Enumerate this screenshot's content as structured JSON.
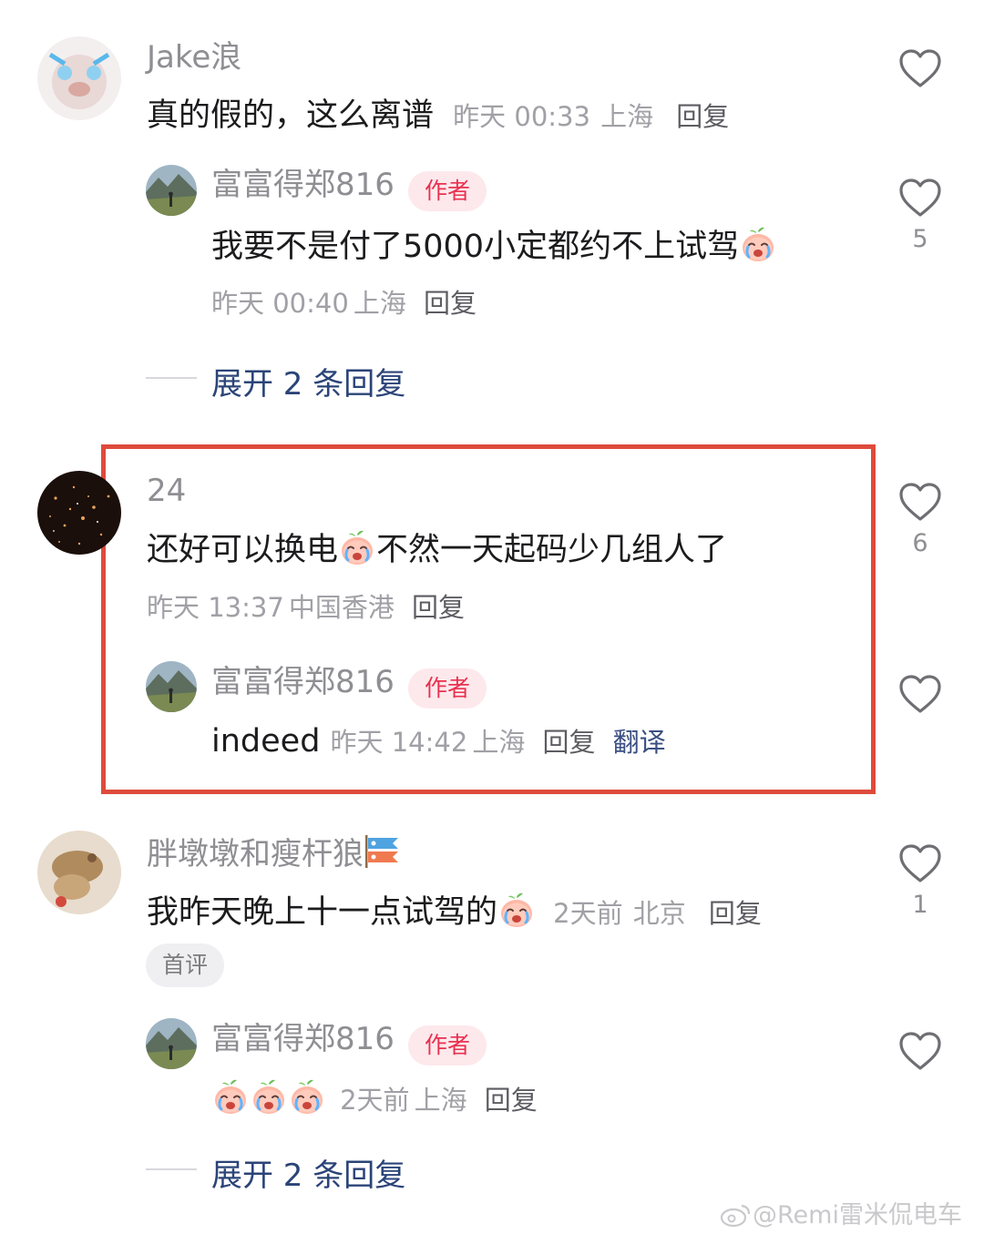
{
  "comments": [
    {
      "user": "Jake浪",
      "text": "真的假的，这么离谱",
      "time": "昨天 00:33",
      "location": "上海",
      "reply_label": "回复",
      "replies": [
        {
          "user": "富富得郑816",
          "badge": "作者",
          "text": "我要不是付了5000小定都约不上试驾",
          "emoji": "crying-peach-emoji",
          "time": "昨天 00:40",
          "location": "上海",
          "reply_label": "回复",
          "likes": "5"
        }
      ],
      "expand_label": "展开 2 条回复"
    },
    {
      "user": "24",
      "text_before": "还好可以换电",
      "text_after": "不然一天起码少几组人了",
      "emoji": "crying-peach-emoji",
      "time": "昨天 13:37",
      "location": "中国香港",
      "reply_label": "回复",
      "likes": "6",
      "highlighted": true,
      "replies": [
        {
          "user": "富富得郑816",
          "badge": "作者",
          "text": "indeed",
          "time": "昨天 14:42",
          "location": "上海",
          "reply_label": "回复",
          "translate_label": "翻译"
        }
      ]
    },
    {
      "user": "胖墩墩和瘦杆狼",
      "user_icon": "koinobori-flag-icon",
      "text": "我昨天晚上十一点试驾的",
      "emoji": "crying-peach-emoji",
      "time": "2天前",
      "location": "北京",
      "reply_label": "回复",
      "likes": "1",
      "tag": "首评",
      "replies": [
        {
          "user": "富富得郑816",
          "badge": "作者",
          "emojis": [
            "crying-peach-emoji",
            "crying-peach-emoji",
            "crying-peach-emoji"
          ],
          "time": "2天前",
          "location": "上海",
          "reply_label": "回复"
        }
      ],
      "expand_label": "展开 2 条回复"
    }
  ],
  "watermark": "@Remi雷米侃电车",
  "colors": {
    "highlight_border": "#de4b3c",
    "author_badge_bg": "#fde8ec",
    "author_badge_text": "#e8314f",
    "expand_text": "#2b4478"
  }
}
